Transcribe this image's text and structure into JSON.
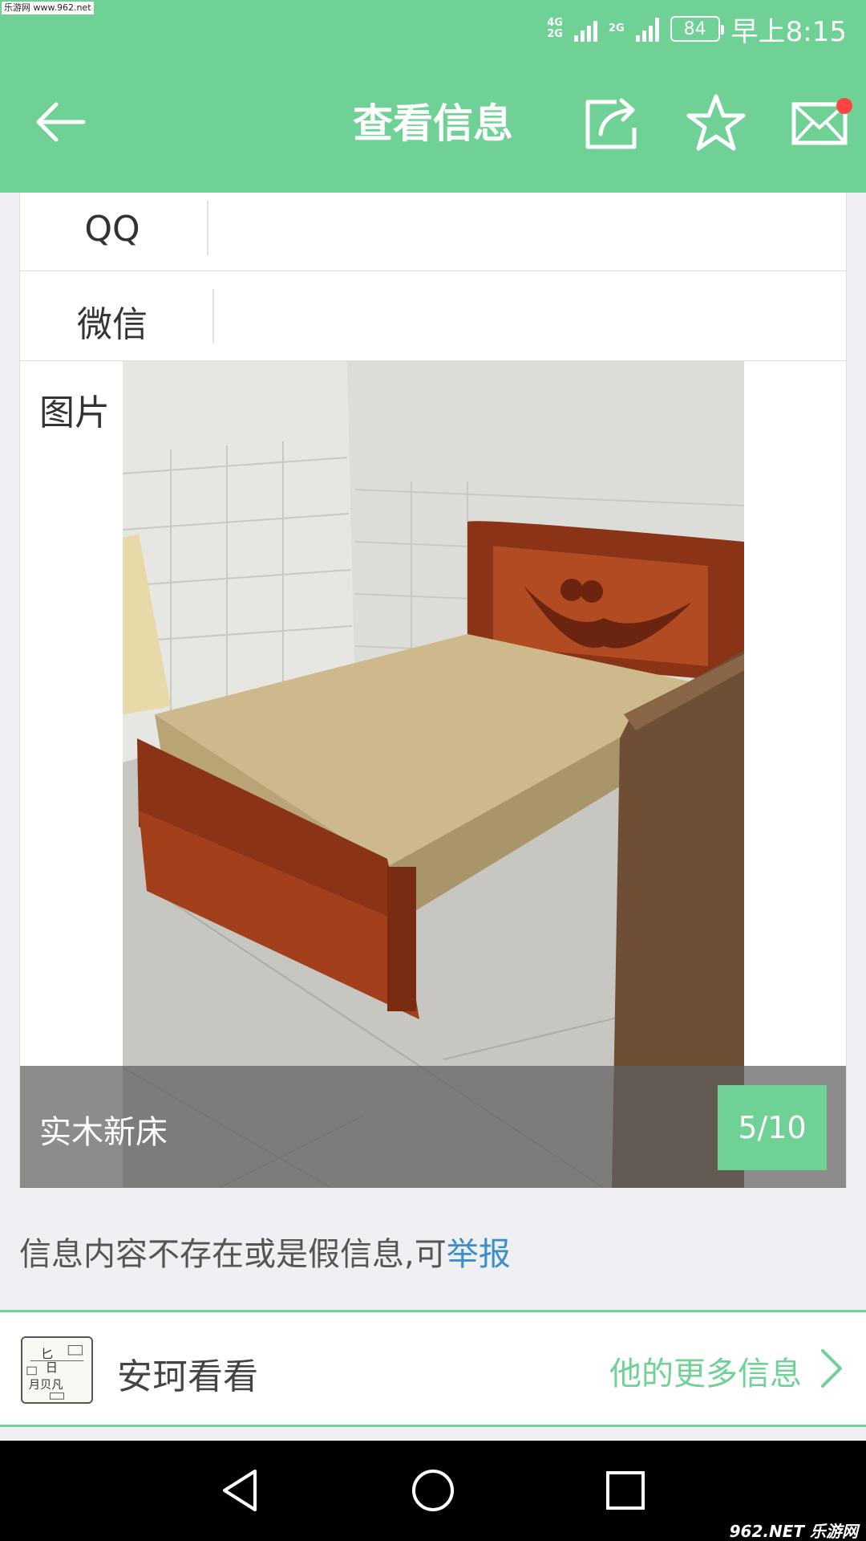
{
  "status_bar": {
    "watermark": "乐游网 www.962.net",
    "net_top": "4G",
    "net_bottom": "2G",
    "net2": "2G",
    "battery": "84",
    "time": "早上8:15"
  },
  "header": {
    "title": "查看信息",
    "icons": [
      "back-arrow-icon",
      "share-icon",
      "star-icon",
      "mail-icon"
    ],
    "accent_color": "#6fd195",
    "notification_dot_color": "#ff4444"
  },
  "contact": {
    "qq_label": "QQ",
    "qq_value": "",
    "wechat_label": "微信",
    "wechat_value": ""
  },
  "pictures": {
    "label": "图片",
    "caption": "实木新床",
    "counter": "5/10"
  },
  "report": {
    "text": "信息内容不存在或是假信息,可",
    "link": "举报",
    "link_color": "#3a8fc8"
  },
  "publisher": {
    "name": "安珂看看",
    "more_link": "他的更多信息"
  },
  "watermark_bottom": "962.NET 乐游网"
}
